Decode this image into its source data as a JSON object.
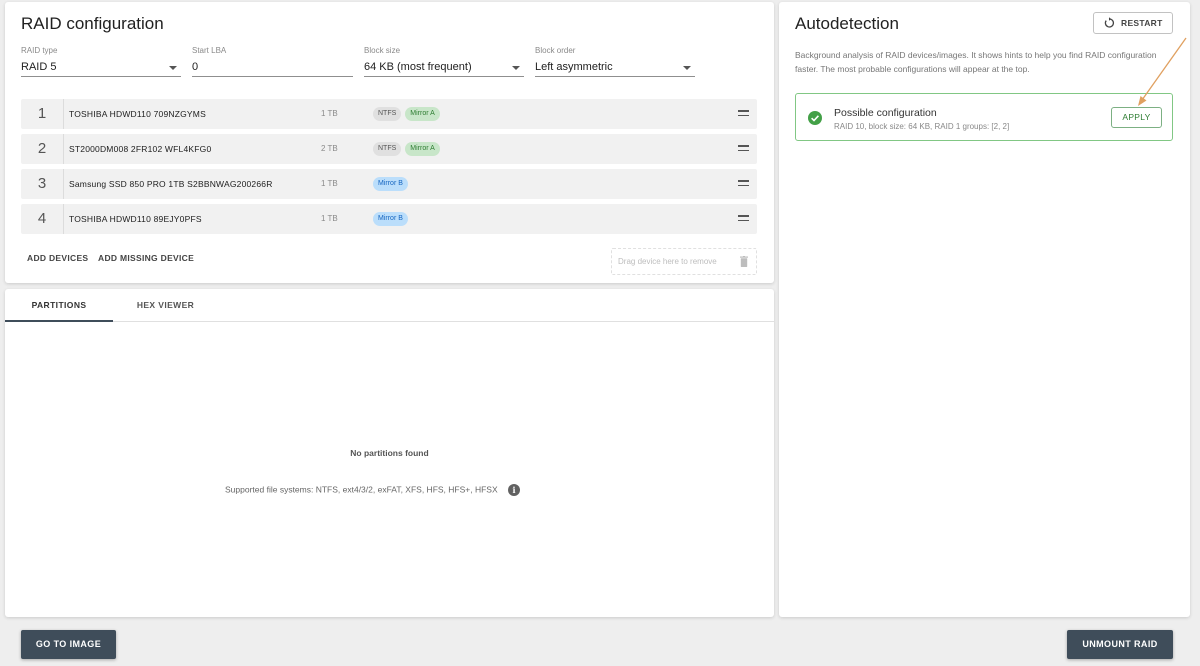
{
  "raid": {
    "title": "RAID configuration",
    "fields": [
      {
        "label": "RAID type",
        "value": "RAID 5",
        "dropdown": true
      },
      {
        "label": "Start LBA",
        "value": "0",
        "dropdown": false
      },
      {
        "label": "Block size",
        "value": "64 KB (most frequent)",
        "dropdown": true
      },
      {
        "label": "Block order",
        "value": "Left asymmetric",
        "dropdown": true
      }
    ],
    "devices": [
      {
        "num": "1",
        "name": "TOSHIBA HDWD110 709NZGYMS",
        "size": "1 TB",
        "chips": [
          "NTFS",
          "Mirror A"
        ]
      },
      {
        "num": "2",
        "name": "ST2000DM008 2FR102 WFL4KFG0",
        "size": "2 TB",
        "chips": [
          "NTFS",
          "Mirror A"
        ]
      },
      {
        "num": "3",
        "name": "Samsung SSD 850 PRO 1TB S2BBNWAG200266R",
        "size": "1 TB",
        "chips": [
          "Mirror B"
        ]
      },
      {
        "num": "4",
        "name": "TOSHIBA HDWD110 89EJY0PFS",
        "size": "1 TB",
        "chips": [
          "Mirror B"
        ]
      }
    ],
    "add_devices": "ADD DEVICES",
    "add_missing": "ADD MISSING DEVICE",
    "drop_hint": "Drag device here to remove"
  },
  "chip_colors": {
    "NTFS": {
      "bg": "#e0e0e0",
      "fg": "#555555"
    },
    "Mirror A": {
      "bg": "#c8e6c9",
      "fg": "#2e7d32"
    },
    "Mirror B": {
      "bg": "#bbdefb",
      "fg": "#1565c0"
    }
  },
  "tabs": [
    {
      "label": "PARTITIONS",
      "active": true
    },
    {
      "label": "HEX VIEWER",
      "active": false
    }
  ],
  "partitions": {
    "empty_title": "No partitions found",
    "supported": "Supported file systems: NTFS, ext4/3/2, exFAT, XFS, HFS, HFS+, HFSX"
  },
  "autodetect": {
    "title": "Autodetection",
    "restart": "RESTART",
    "description": "Background analysis of RAID devices/images. It shows hints to help you find RAID configuration faster. The most probable configurations will appear at the top.",
    "config_title": "Possible configuration",
    "config_detail": "RAID 10, block size: 64 KB, RAID 1 groups: [2, 2]",
    "apply": "APPLY"
  },
  "footer": {
    "go_to_image": "GO TO IMAGE",
    "unmount": "UNMOUNT RAID"
  },
  "colors": {
    "primary_button": "#3f4d5a",
    "success": "#43a047",
    "annotation_arrow": "#e0a060"
  }
}
